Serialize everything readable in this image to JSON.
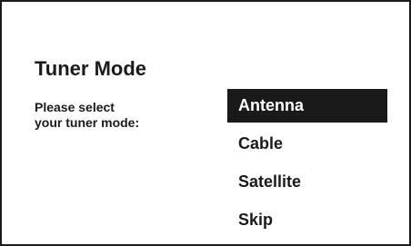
{
  "dialog": {
    "title": "Tuner Mode",
    "prompt_line1": "Please select",
    "prompt_line2": "your tuner mode:"
  },
  "options": [
    {
      "label": "Antenna",
      "selected": true
    },
    {
      "label": "Cable",
      "selected": false
    },
    {
      "label": "Satellite",
      "selected": false
    },
    {
      "label": "Skip",
      "selected": false
    }
  ],
  "colors": {
    "background": "#ffffff",
    "foreground": "#1a1a1a",
    "highlight": "#1a1a1a",
    "highlight_text": "#ffffff"
  }
}
